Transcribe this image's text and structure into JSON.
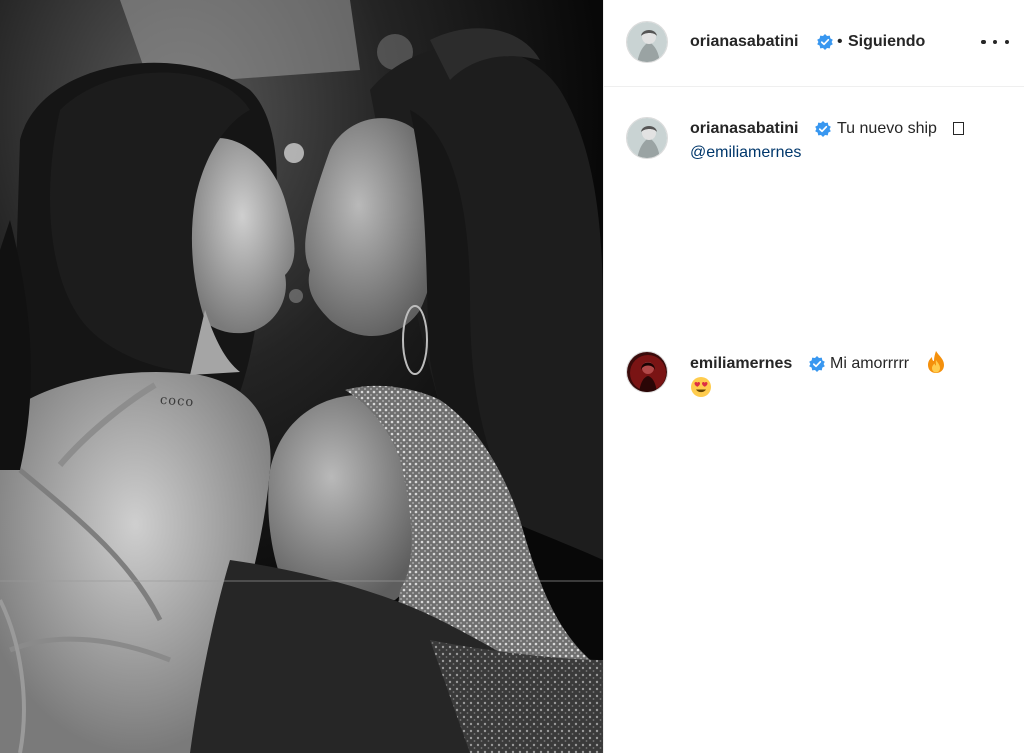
{
  "post": {
    "author": {
      "username": "orianasabatini",
      "verified": true,
      "follow_status": "Siguiendo",
      "separator": "•"
    },
    "more_options_icon": "more-horizontal-icon",
    "photo": {
      "tattoo_text": "coco",
      "style": "black-and-white"
    }
  },
  "caption": {
    "username": "orianasabatini",
    "verified": true,
    "text": "Tu nuevo ship",
    "trailing_glyph": "missing-emoji-box",
    "mention": "@emiliamernes"
  },
  "comments": [
    {
      "username": "emiliamernes",
      "verified": true,
      "text": "Mi amorrrrr",
      "emojis": [
        "fire-emoji",
        "heart-eyes-emoji"
      ]
    }
  ],
  "colors": {
    "text": "#262626",
    "mention": "#00376b",
    "verified": "#3897f0",
    "divider": "#efefef"
  }
}
